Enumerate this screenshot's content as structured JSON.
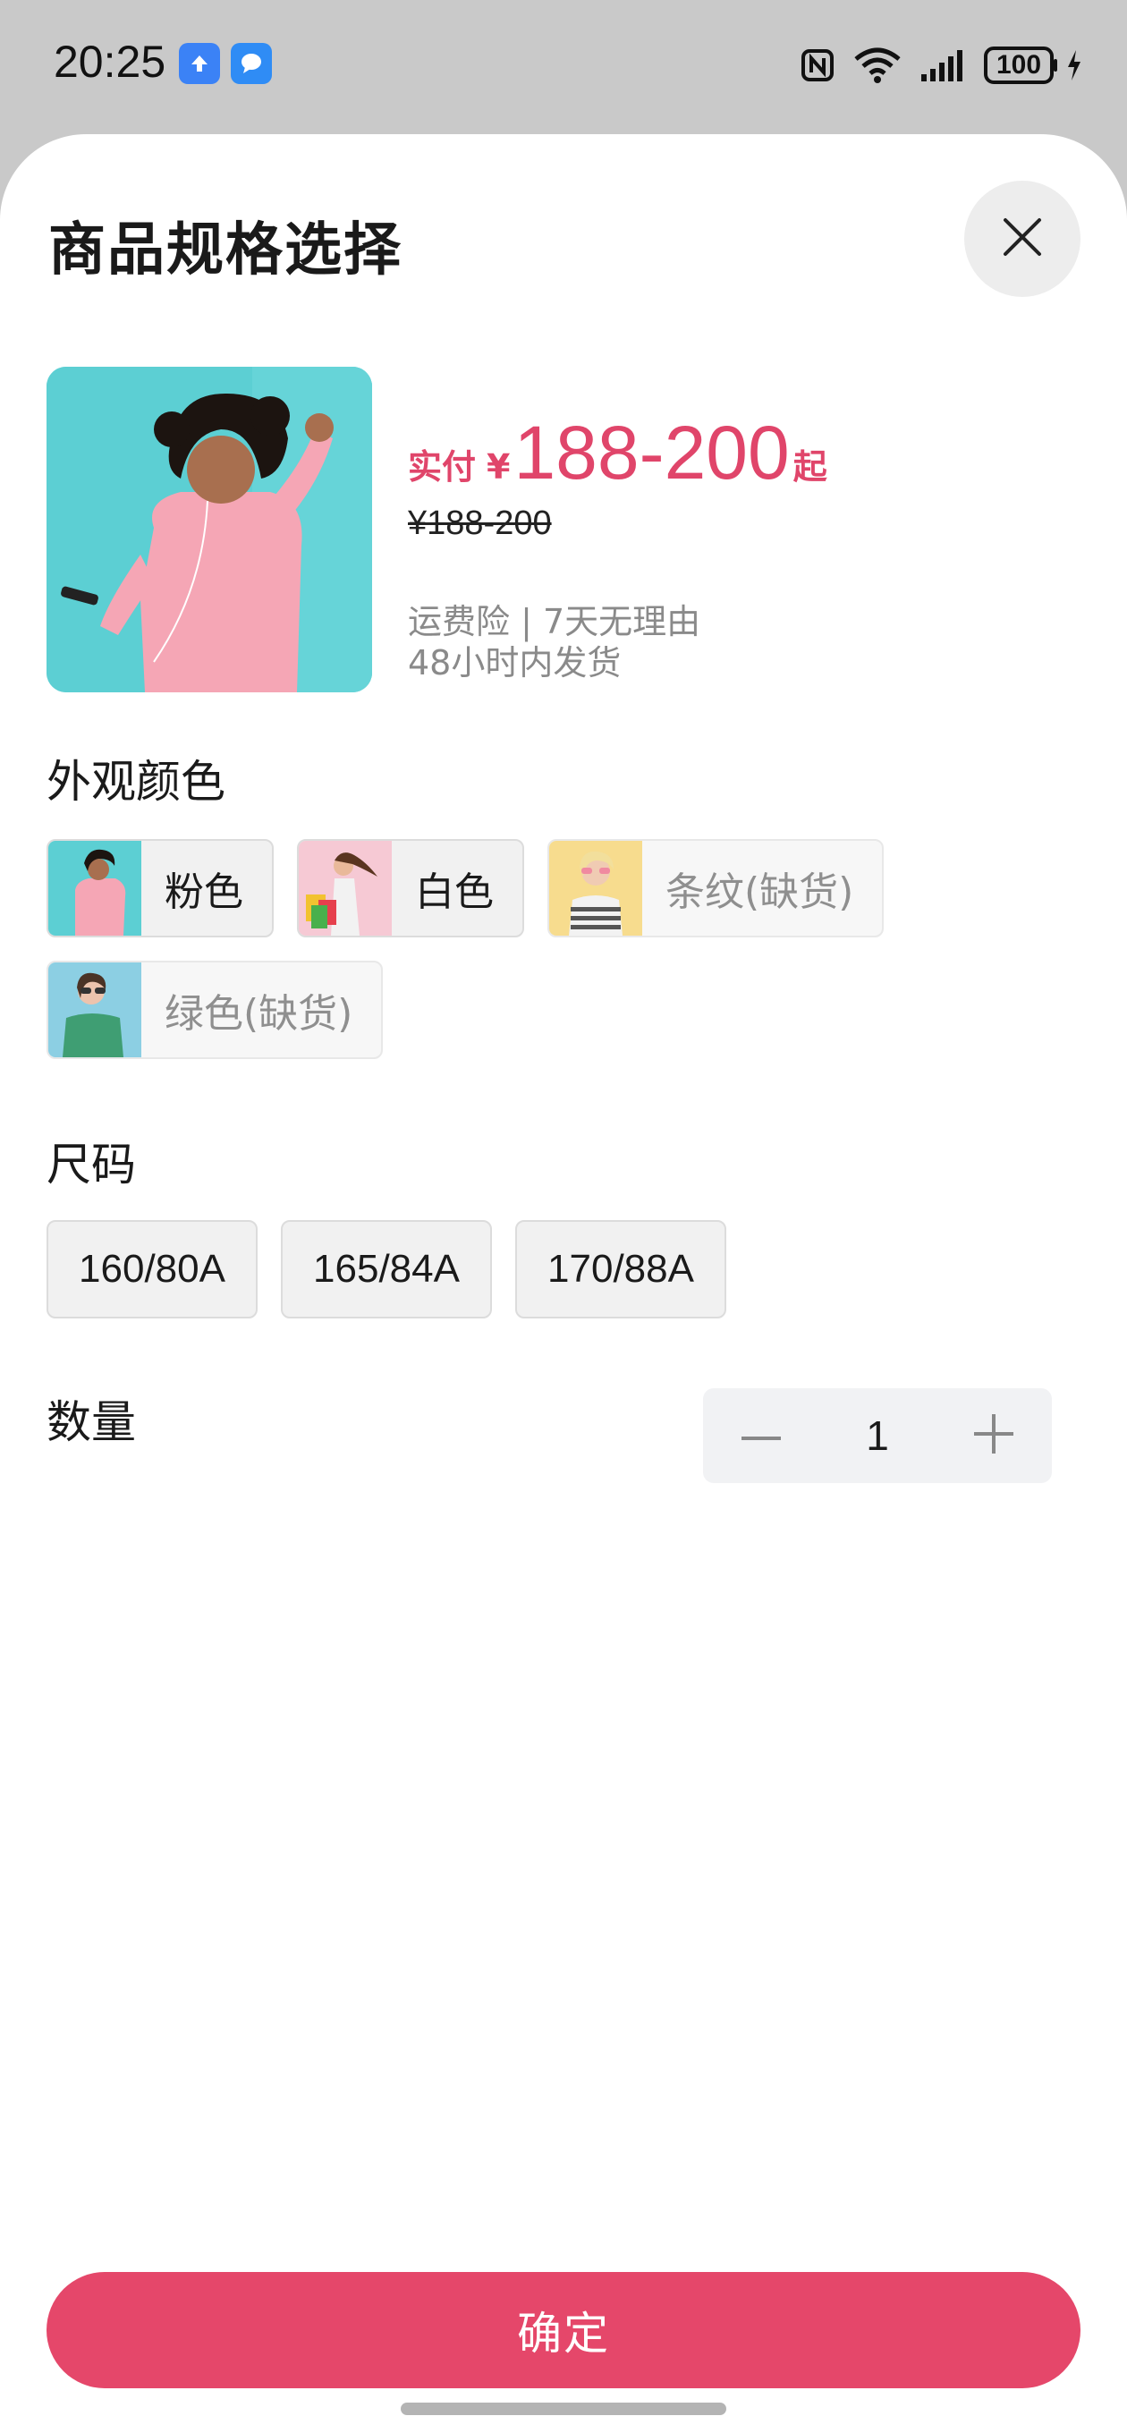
{
  "status_bar": {
    "time": "20:25",
    "battery": "100",
    "icons": [
      "upload-app-icon",
      "message-app-icon",
      "nfc-icon",
      "wifi-icon",
      "signal-icon",
      "battery-icon",
      "charging-icon"
    ]
  },
  "sheet": {
    "title": "商品规格选择",
    "close_icon": "close-icon"
  },
  "product": {
    "price_prefix": "实付",
    "currency": "¥",
    "price_range": "188-200",
    "price_suffix": "起",
    "original_price": "¥188-200",
    "services_line1": "运费险 | 7天无理由",
    "services_line2": "48小时内发货"
  },
  "color_section": {
    "title": "外观颜色",
    "options": [
      {
        "label": "粉色",
        "available": true
      },
      {
        "label": "白色",
        "available": true
      },
      {
        "label": "条纹(缺货)",
        "available": false
      },
      {
        "label": "绿色(缺货)",
        "available": false
      }
    ]
  },
  "size_section": {
    "title": "尺码",
    "options": [
      "160/80A",
      "165/84A",
      "170/88A"
    ]
  },
  "quantity_section": {
    "title": "数量",
    "value": "1"
  },
  "confirm_label": "确定",
  "colors": {
    "accent": "#e5476a",
    "price": "#e0456a",
    "disabled_text": "#8f8f8f",
    "option_bg": "#f1f1f1"
  }
}
